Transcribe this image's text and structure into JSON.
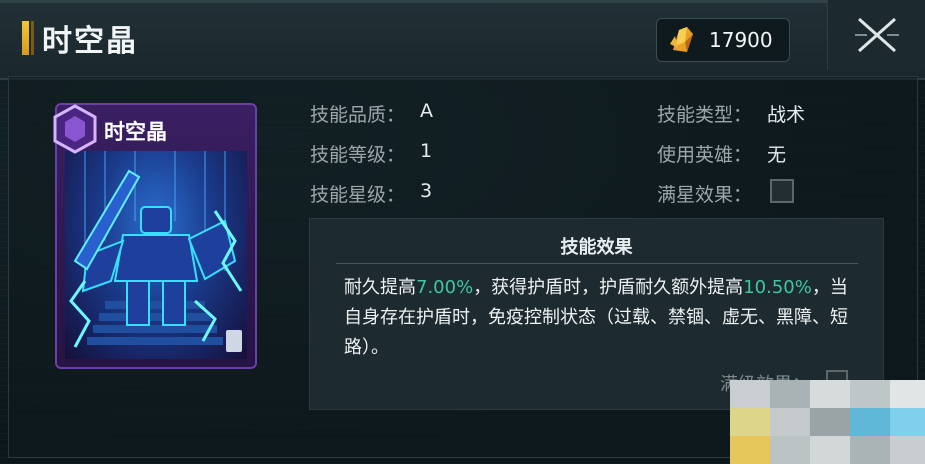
{
  "header": {
    "title": "时空晶",
    "currency_icon": "crystal-shard-icon",
    "currency_value": "17900",
    "close_icon": "close-x-icon"
  },
  "card": {
    "name": "时空晶",
    "badge_icon": "hexagon-skill-icon",
    "border_color": "#6a3fa8"
  },
  "info": {
    "quality_label": "技能品质：",
    "quality_value": "A",
    "level_label": "技能等级：",
    "level_value": "1",
    "star_label": "技能星级：",
    "star_value": "3",
    "type_label": "技能类型：",
    "type_value": "战术",
    "hero_label": "使用英雄：",
    "hero_value": "无",
    "fullstar_label": "满星效果："
  },
  "effect": {
    "title": "技能效果",
    "text_1": "耐久提高",
    "pct_1": "7.00%",
    "text_2": "，获得护盾时，护盾耐久额外提高",
    "pct_2": "10.50%",
    "text_3": "，当自身存在护盾时，免疫控制状态（过载、禁锢、虚无、黑障、短路）。",
    "highlight_color": "#3fc7a0"
  },
  "max_level": {
    "label": "满级效果："
  }
}
